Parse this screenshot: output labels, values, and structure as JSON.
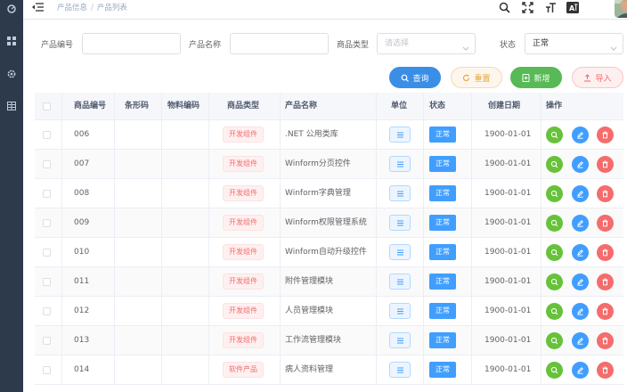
{
  "breadcrumb": [
    "产品信息",
    "产品列表"
  ],
  "filters": {
    "product_code_label": "产品编号",
    "product_code_value": "",
    "product_name_label": "产品名称",
    "product_name_value": "",
    "product_type_label": "商品类型",
    "product_type_placeholder": "请选择",
    "status_label": "状态",
    "status_value": "正常"
  },
  "actions": {
    "query": "查询",
    "reset": "重置",
    "add": "新增",
    "import": "导入"
  },
  "table": {
    "headers": {
      "code": "商品编号",
      "barcode": "条形码",
      "material": "物料编码",
      "type": "商品类型",
      "name": "产品名称",
      "unit": "单位",
      "status": "状态",
      "created": "创建日期",
      "ops": "操作"
    },
    "rows": [
      {
        "code": "006",
        "type": "开发组件",
        "name": ".NET 公用类库",
        "status": "正常",
        "created": "1900-01-01"
      },
      {
        "code": "007",
        "type": "开发组件",
        "name": "Winform分页控件",
        "status": "正常",
        "created": "1900-01-01"
      },
      {
        "code": "008",
        "type": "开发组件",
        "name": "Winform字典管理",
        "status": "正常",
        "created": "1900-01-01"
      },
      {
        "code": "009",
        "type": "开发组件",
        "name": "Winform权限管理系统",
        "status": "正常",
        "created": "1900-01-01"
      },
      {
        "code": "010",
        "type": "开发组件",
        "name": "Winform自动升级控件",
        "status": "正常",
        "created": "1900-01-01"
      },
      {
        "code": "011",
        "type": "开发组件",
        "name": "附件管理模块",
        "status": "正常",
        "created": "1900-01-01"
      },
      {
        "code": "012",
        "type": "开发组件",
        "name": "人员管理模块",
        "status": "正常",
        "created": "1900-01-01"
      },
      {
        "code": "013",
        "type": "开发组件",
        "name": "工作流管理模块",
        "status": "正常",
        "created": "1900-01-01"
      },
      {
        "code": "014",
        "type": "软件产品",
        "name": "病人资料管理",
        "status": "正常",
        "created": "1900-01-01"
      }
    ]
  },
  "icons": {
    "sidebar": [
      "dashboard-icon",
      "grid-icon",
      "settings-icon",
      "table-icon"
    ],
    "header": [
      "menu-fold-icon",
      "search-icon",
      "fullscreen-icon",
      "font-size-icon",
      "language-icon"
    ]
  },
  "colors": {
    "sidebar_bg": "#2d3a4b",
    "primary": "#409eff",
    "success": "#67c23a",
    "danger": "#f56c6c",
    "warning": "#e6a23c"
  }
}
